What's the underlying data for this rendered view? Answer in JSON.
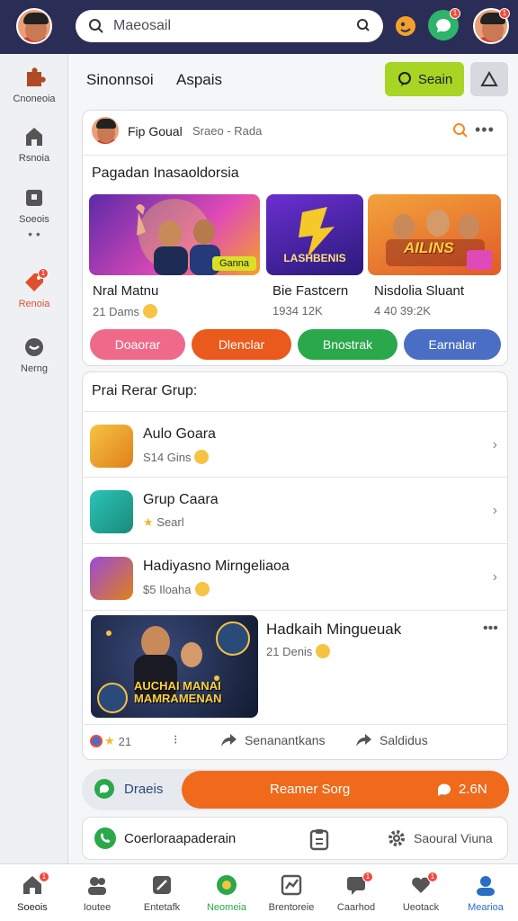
{
  "header": {
    "search_placeholder": "Maeosail",
    "notification_count": "1"
  },
  "sidebar": {
    "items": [
      {
        "label": "Cnoneoia"
      },
      {
        "label": "Rsnoia"
      },
      {
        "label": "Soeois"
      },
      {
        "label": "Renoia"
      },
      {
        "label": "Nerng"
      }
    ]
  },
  "tabs": {
    "tab1": "Sinonnsoi",
    "tab2": "Aspais",
    "button": "Seain"
  },
  "post": {
    "author": "Fip Goual",
    "meta": "Sraeo - Rada",
    "section_title": "Pagadan Inasaoldorsia",
    "tiles": [
      {
        "overlay": "Ganna",
        "title": "Nral Matnu",
        "sub": "21 Dams"
      },
      {
        "overlay": "LASHBENIS",
        "title": "Bie Fastcern",
        "sub": "1934 12K"
      },
      {
        "overlay": "AILINS",
        "title": "Nisdolia Sluant",
        "sub": "4 40 39:2K"
      }
    ],
    "pills": [
      "Doaorar",
      "Dlenclar",
      "Bnostrak",
      "Earnalar"
    ]
  },
  "groups": {
    "title": "Prai Rerar Grup:",
    "rows": [
      {
        "title": "Aulo Goara",
        "sub": "S14 Gins"
      },
      {
        "title": "Grup Caara",
        "sub": "Searl"
      },
      {
        "title": "Hadiyasno Mirngeliaoa",
        "sub": "$5 Iloaha"
      }
    ],
    "feature": {
      "title": "Hadkaih Mingueuak",
      "sub": "21 Denis",
      "image_text": "AUCHAI MANAI MAMRAMENAN"
    },
    "reactions": {
      "count": "21",
      "comment": "Senanantkans",
      "share": "Saldidus"
    }
  },
  "action_bar": {
    "left": "Draeis",
    "center": "Reamer Sorg",
    "right": "2.6N"
  },
  "footer_bar": {
    "item1": "Coerloraapaderain",
    "item2": "Saoural Viuna"
  },
  "bottom_nav": [
    {
      "label": "Soeois"
    },
    {
      "label": "Ioutee"
    },
    {
      "label": "Entetafk"
    },
    {
      "label": "Neomeia"
    },
    {
      "label": "Brentoreie"
    },
    {
      "label": "Caarhod"
    },
    {
      "label": "Ueotack"
    },
    {
      "label": "Mearioa"
    }
  ]
}
